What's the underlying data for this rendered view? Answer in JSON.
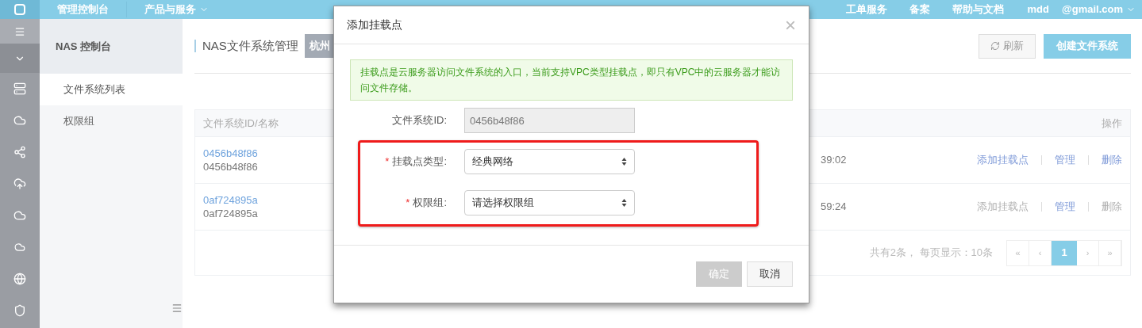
{
  "top_bar": {
    "console": "管理控制台",
    "products": "产品与服务",
    "items": [
      "工单服务",
      "备案",
      "帮助与文档"
    ],
    "user": "mdd",
    "email": "@gmail.com"
  },
  "side_nav": {
    "title": "NAS 控制台",
    "items": [
      {
        "label": "文件系统列表",
        "selected": true
      },
      {
        "label": "权限组",
        "selected": false
      }
    ]
  },
  "page": {
    "title": "NAS文件系统管理",
    "region": "杭州",
    "refresh": "刷新",
    "create": "创建文件系统"
  },
  "table": {
    "columns": [
      "文件系统ID/名称",
      "操作"
    ],
    "rows": [
      {
        "id": "0456b48f86",
        "name": "0456b48f86",
        "time": "39:02",
        "actions": [
          {
            "label": "添加挂载点",
            "disabled": false
          },
          {
            "label": "管理",
            "disabled": false
          },
          {
            "label": "删除",
            "disabled": false
          }
        ]
      },
      {
        "id": "0af724895a",
        "name": "0af724895a",
        "time": "59:24",
        "actions": [
          {
            "label": "添加挂载点",
            "disabled": true
          },
          {
            "label": "管理",
            "disabled": false
          },
          {
            "label": "删除",
            "disabled": true
          }
        ]
      }
    ],
    "summary": "共有2条， 每页显示：10条",
    "pages": [
      {
        "label": "«",
        "selected": false
      },
      {
        "label": "‹",
        "selected": false
      },
      {
        "label": "1",
        "selected": true
      },
      {
        "label": "›",
        "selected": false
      },
      {
        "label": "»",
        "selected": false
      }
    ]
  },
  "dialog": {
    "title": "添加挂载点",
    "close": "×",
    "required_symbol": "*",
    "notice": "挂载点是云服务器访问文件系统的入口，当前支持VPC类型挂载点，即只有VPC中的云服务器才能访问文件存储。",
    "fields": [
      {
        "kind": "input",
        "label": "文件系统ID:",
        "value": "0456b48f86",
        "required": false,
        "disabled": true
      },
      {
        "kind": "select",
        "label": "挂载点类型:",
        "value": "经典网络",
        "required": true,
        "disabled": false
      },
      {
        "kind": "select",
        "label": "权限组:",
        "value": "请选择权限组",
        "required": true,
        "disabled": false
      }
    ],
    "buttons": [
      {
        "label": "确定",
        "disabled": true
      },
      {
        "label": "取消",
        "disabled": false
      }
    ]
  }
}
